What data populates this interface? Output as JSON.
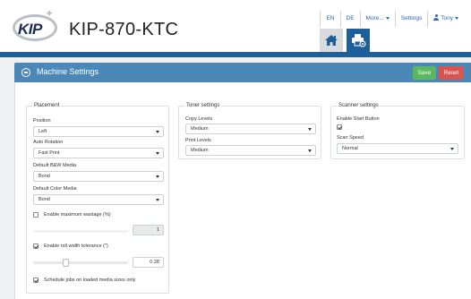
{
  "header": {
    "logo_text": "KIP",
    "product_title": "KIP-870-KTC",
    "nav": {
      "lang_en": "EN",
      "lang_de": "DE",
      "more": "More...",
      "settings": "Settings",
      "user": "Tony"
    }
  },
  "panel": {
    "title": "Machine Settings",
    "save_label": "Save",
    "reset_label": "Reset"
  },
  "placement": {
    "legend": "Placement",
    "position_label": "Position",
    "position_value": "Left",
    "auto_rotation_label": "Auto Rotation",
    "auto_rotation_value": "Fast Print",
    "default_bw_label": "Default B&W Media",
    "default_bw_value": "Bond",
    "default_color_label": "Default Color Media",
    "default_color_value": "Bond",
    "enable_max_wastage_label": "Enable maximum wastage (%)",
    "enable_max_wastage_checked": false,
    "max_wastage_value": "1",
    "enable_roll_width_label": "Enable roll width tolerance (\")",
    "enable_roll_width_checked": true,
    "roll_width_value": "0.28",
    "schedule_jobs_label": "Schedule jobs on loaded media sizes only",
    "schedule_jobs_checked": true
  },
  "toner": {
    "legend": "Toner settings",
    "copy_levels_label": "Copy Levels",
    "copy_levels_value": "Medium",
    "print_levels_label": "Print Levels",
    "print_levels_value": "Medium"
  },
  "scanner": {
    "legend": "Scanner settings",
    "enable_start_label": "Enable Start Button",
    "enable_start_checked": true,
    "scan_speed_label": "Scan Speed",
    "scan_speed_value": "Normal"
  },
  "colors": {
    "brand_blue": "#1f5f99",
    "panel_header": "#4b88b8",
    "save_green": "#5cb85c",
    "reset_red": "#d9534f",
    "link_blue": "#2a6ab1"
  },
  "icons": {
    "home_tab": "home-icon",
    "printer_tab": "printer-settings-icon",
    "collapse": "minus-circle-icon",
    "user": "user-icon"
  }
}
